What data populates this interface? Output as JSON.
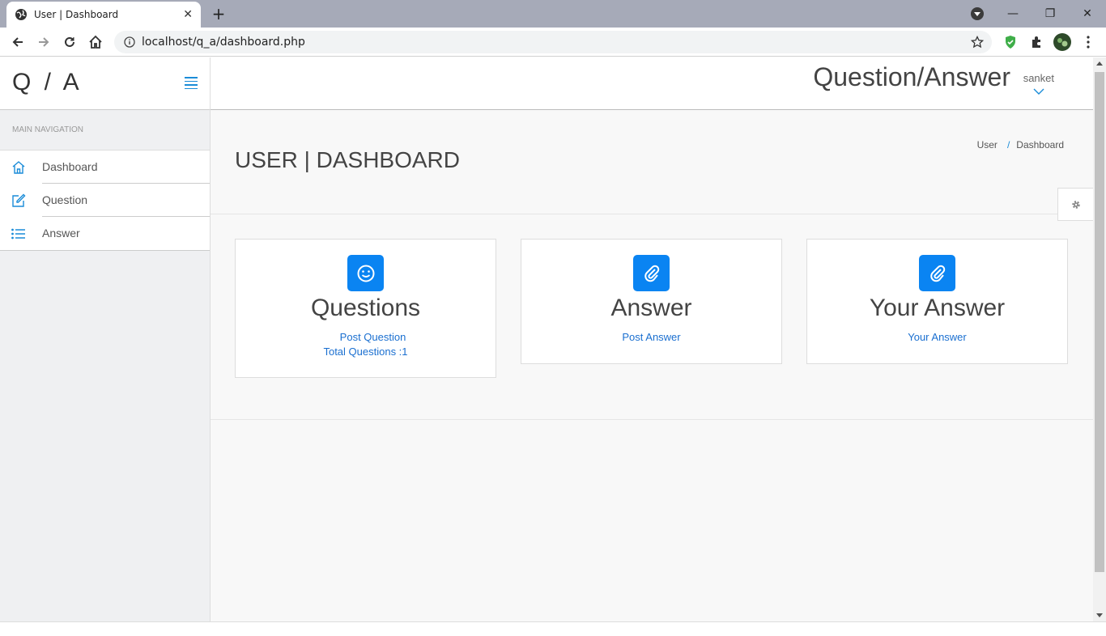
{
  "browser": {
    "tab_title": "User | Dashboard",
    "tab_close": "✕",
    "new_tab": "+",
    "url": "localhost/q_a/dashboard.php",
    "window_minimize": "—",
    "window_restore": "❐",
    "window_close": "✕"
  },
  "sidebar": {
    "logo": "Q / A",
    "nav_header": "MAIN NAVIGATION",
    "items": [
      {
        "label": "Dashboard",
        "icon": "home-icon"
      },
      {
        "label": "Question",
        "icon": "edit-icon"
      },
      {
        "label": "Answer",
        "icon": "list-icon"
      }
    ]
  },
  "header": {
    "title": "Question/Answer",
    "user_name": "sanket"
  },
  "page": {
    "title": "USER | DASHBOARD",
    "breadcrumb": [
      "User",
      "/",
      "Dashboard"
    ]
  },
  "cards": [
    {
      "icon": "smile-icon",
      "title": "Questions",
      "links": [
        "Post Question",
        "Total Questions :1"
      ]
    },
    {
      "icon": "paperclip-icon",
      "title": "Answer",
      "links": [
        "Post Answer"
      ]
    },
    {
      "icon": "paperclip-icon",
      "title": "Your Answer",
      "links": [
        "Your Answer"
      ]
    }
  ],
  "colors": {
    "accent": "#0a84f2",
    "link": "#1a6fd0",
    "sidebar_bg": "#eff0f2"
  }
}
